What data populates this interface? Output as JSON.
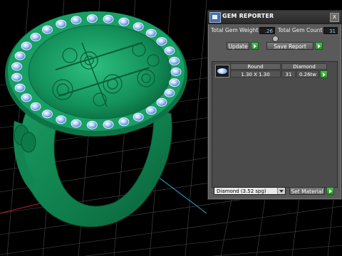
{
  "panel": {
    "title": "GEM REPORTER",
    "icon": "gem-reporter-app-icon",
    "close_label": "x",
    "total_weight_label": "Total Gem Weight",
    "total_weight_value": ".26",
    "total_count_label": "Total Gem Count",
    "total_count_value": "31",
    "update_label": "Update",
    "save_report_label": "Save Report",
    "table": {
      "headers": [
        "Round",
        "Diamond"
      ],
      "row": {
        "size": "1.30 X 1.30",
        "count": "31",
        "weight": "0.26tw"
      }
    },
    "material_select_value": "Diamond   (3.52 spg)",
    "set_material_label": "Set Material"
  },
  "colors": {
    "ring_green": "#1f9a62",
    "gem_blue": "#9ec7ff",
    "panel_bg": "#5a5a5a",
    "go_green": "#3db33e",
    "field_text": "#8fd3ff"
  }
}
